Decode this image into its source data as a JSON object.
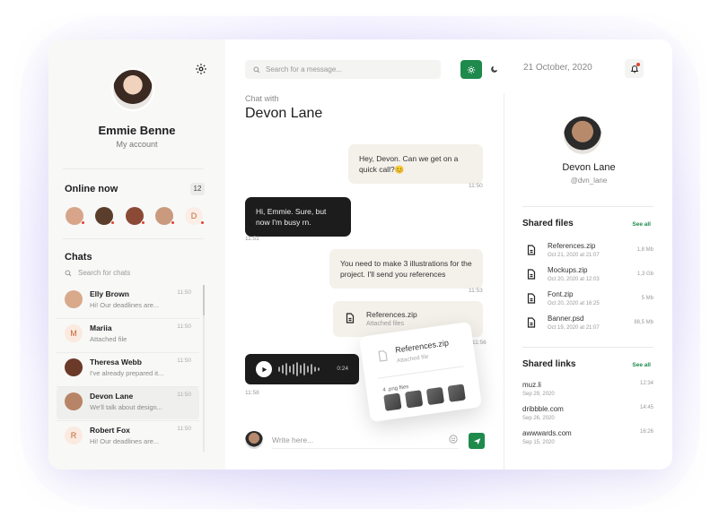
{
  "sidebar": {
    "user_name": "Emmie Benne",
    "user_sub": "My account",
    "online_title": "Online now",
    "online_count": "12",
    "online_users": [
      {
        "initial": "",
        "color": "#d8a58a"
      },
      {
        "initial": "",
        "color": "#5a3d2b"
      },
      {
        "initial": "",
        "color": "#8b4a35"
      },
      {
        "initial": "",
        "color": "#c99a7d"
      },
      {
        "initial": "D",
        "color": "#fbeee6"
      }
    ],
    "chats_title": "Chats",
    "search_placeholder": "Search for chats",
    "chats": [
      {
        "name": "Elly Brown",
        "message": "Hi! Our deadlines are...",
        "time": "11:50",
        "initial": ""
      },
      {
        "name": "Mariia",
        "message": "Attached file",
        "time": "11:50",
        "initial": "M"
      },
      {
        "name": "Theresa Webb",
        "message": "I've already prepared it...",
        "time": "11:50",
        "initial": ""
      },
      {
        "name": "Devon Lane",
        "message": "We'll talk about design...",
        "time": "11:50",
        "initial": ""
      },
      {
        "name": "Robert Fox",
        "message": "Hi! Our deadlines are...",
        "time": "11:50",
        "initial": "R"
      }
    ]
  },
  "main": {
    "search_placeholder": "Search for a message...",
    "chat_with_label": "Chat with",
    "chat_title": "Devon Lane",
    "messages": [
      {
        "text": "Hey, Devon. Can we get on a quick call?😊",
        "time": "11:50",
        "direction": "in"
      },
      {
        "text": "Hi, Emmie. Sure, but now I'm busy rn.",
        "time": "11:51",
        "direction": "out"
      },
      {
        "text": "You need to make 3 illustrations for the project. I'll send you references",
        "time": "11:53",
        "direction": "in"
      }
    ],
    "file_message": {
      "name": "References.zip",
      "sub": "Attached files",
      "time": "11:56"
    },
    "voice_message": {
      "duration": "0:24",
      "time": "11:58"
    },
    "popup": {
      "name": "References.zip",
      "sub": "Attached file",
      "label": "4 .png files"
    },
    "compose_placeholder": "Write here..."
  },
  "right": {
    "date": "21 October, 2020",
    "profile_name": "Devon Lane",
    "profile_handle": "@dvn_lane",
    "files_title": "Shared files",
    "see_all": "See all",
    "files": [
      {
        "name": "References.zip",
        "date": "Oct 21, 2020 at 21:07",
        "size": "1,8 Mb"
      },
      {
        "name": "Mockups.zip",
        "date": "Oct 20, 2020 at 12:03",
        "size": "1,3 Gb"
      },
      {
        "name": "Font.zip",
        "date": "Oct 20, 2020 at 16:25",
        "size": "5 Mb"
      },
      {
        "name": "Banner.psd",
        "date": "Oct 19, 2020 at 21:07",
        "size": "88,5 Mb"
      }
    ],
    "links_title": "Shared links",
    "links": [
      {
        "name": "muz.li",
        "date": "Sep 29, 2020",
        "time": "12:34"
      },
      {
        "name": "dribbble.com",
        "date": "Sep 26, 2020",
        "time": "14:45"
      },
      {
        "name": "awwwards.com",
        "date": "Sep 15, 2020",
        "time": "16:26"
      }
    ]
  },
  "colors": {
    "accent": "#1e8a4c",
    "status_dot": "#e0442b",
    "dark_bubble": "#1c1c1c",
    "light_bubble": "#f4f0ea"
  }
}
